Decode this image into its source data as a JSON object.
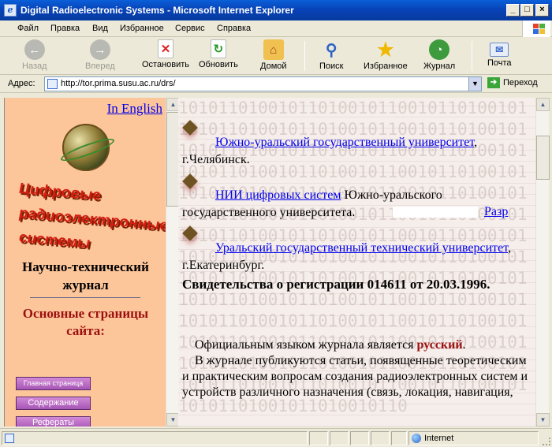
{
  "window": {
    "title": "Digital Radioelectronic Systems - Microsoft Internet Explorer"
  },
  "menu": [
    "Файл",
    "Правка",
    "Вид",
    "Избранное",
    "Сервис",
    "Справка"
  ],
  "toolbar": {
    "back": "Назад",
    "forward": "Вперед",
    "stop": "Остановить",
    "refresh": "Обновить",
    "home": "Домой",
    "search": "Поиск",
    "favorites": "Избранное",
    "history": "Журнал",
    "mail": "Почта"
  },
  "address": {
    "label": "Адрес:",
    "url": "http://tor.prima.susu.ac.ru/drs/",
    "go": "Переход"
  },
  "left": {
    "english_link": "In English",
    "logo_lines": [
      "Цифровые",
      "радиоэлектронные",
      "системы"
    ],
    "journal_title": "Научно-технический журнал",
    "main_pages": "Основные страницы сайта:",
    "nav": [
      "Главная страница",
      "Содержание",
      "Рефераты"
    ]
  },
  "main": {
    "entries": [
      {
        "link": "Южно-уральский государственный университет",
        "rest": ", г.Челябинск."
      },
      {
        "link": "НИИ цифровых систем",
        "rest": " Южно-уральского государственного университета."
      },
      {
        "link": "Уральский государственный технический университет",
        "rest": ", г.Екатеринбург."
      }
    ],
    "razr": "Разр",
    "registration": "Свидетельства о регистрации 014611 от 20.03.1996.",
    "para1_a": "Официальным языком журнала является ",
    "para1_b": "русский",
    "para1_c": ".",
    "para2": "В журнале публикуются статьи, появященные теоретическим и практическим вопросам создания радиоэлектронных систем и устройств различного назначения (связь, локация, навигация,"
  },
  "status": {
    "zone": "Internet"
  }
}
